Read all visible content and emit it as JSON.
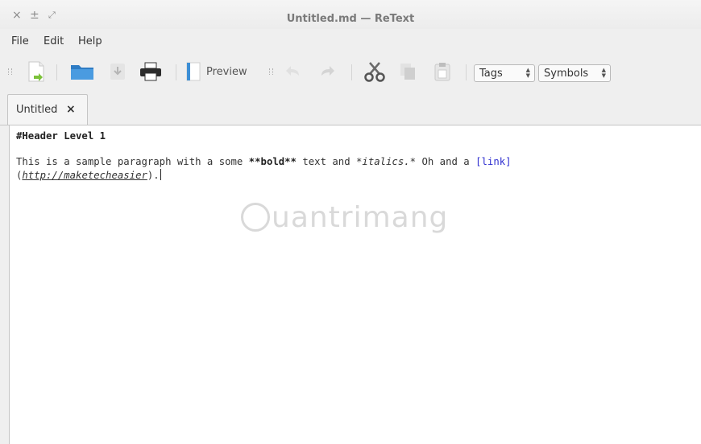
{
  "window": {
    "title": "Untitled.md — ReText",
    "controls": {
      "close": "×",
      "minimize": "±",
      "maximize": "⤢"
    }
  },
  "menu": {
    "items": [
      "File",
      "Edit",
      "Help"
    ]
  },
  "toolbar": {
    "preview_label": "Preview",
    "tags_combo": "Tags",
    "symbols_combo": "Symbols"
  },
  "tabs": [
    {
      "label": "Untitled",
      "close": "×"
    }
  ],
  "editor": {
    "line1": "#Header Level 1",
    "line2_a": "This is a sample paragraph with a some ",
    "line2_bold": "**bold**",
    "line2_b": " text and ",
    "line2_italic": "*italics.*",
    "line2_c": " Oh and a ",
    "line2_link": "[link]",
    "line3_open": "(",
    "line3_url": "http://maketecheasier",
    "line3_close": ")."
  },
  "watermark": {
    "text": "uantrimang",
    "icon": "lightbulb-icon"
  },
  "colors": {
    "link": "#2f2fd0",
    "folder": "#3d8fd6",
    "new_doc_arrow": "#7cc23a"
  }
}
